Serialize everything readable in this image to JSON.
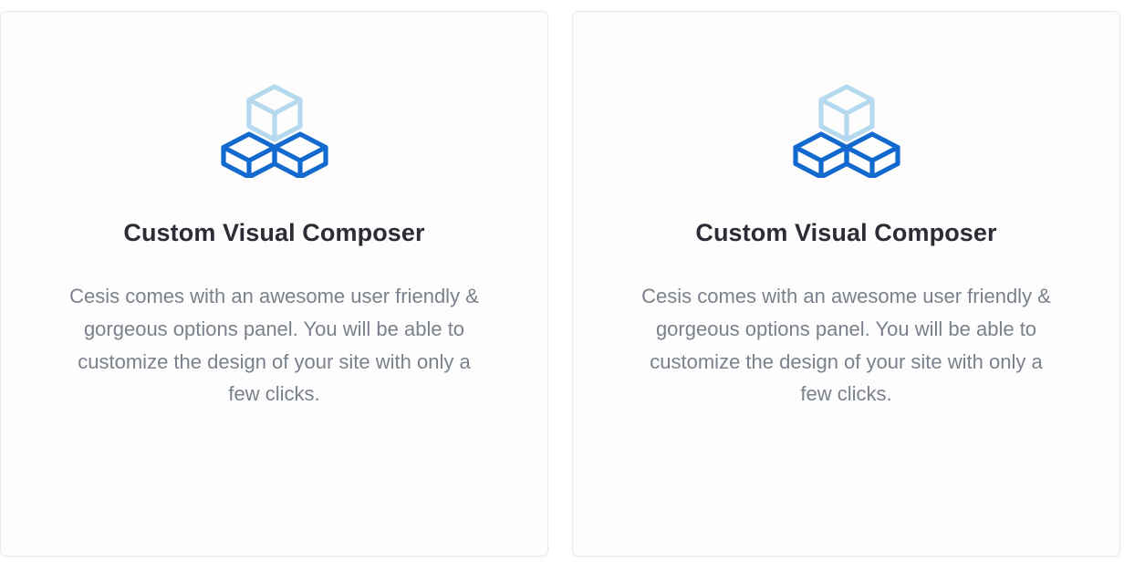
{
  "page": {
    "background_color": "#ffffff"
  },
  "theme": {
    "card_background": "#fdfdfd",
    "card_border": "#e7eaed",
    "title_color": "#2c2c35",
    "body_color": "#7a818b",
    "icon_primary_color": "#1269ce",
    "icon_secondary_color": "#b5d9ee"
  },
  "cards": [
    {
      "icon_name": "stacked-cubes-icon",
      "title": "Custom Visual Composer",
      "description": "Cesis comes with an awesome user friendly & gorgeous options panel. You will be able to customize the design of your site with only a few clicks."
    },
    {
      "icon_name": "stacked-cubes-icon",
      "title": "Custom Visual Composer",
      "description": "Cesis comes with an awesome user friendly & gorgeous options panel. You will be able to customize the design of your site with only a few clicks."
    }
  ]
}
